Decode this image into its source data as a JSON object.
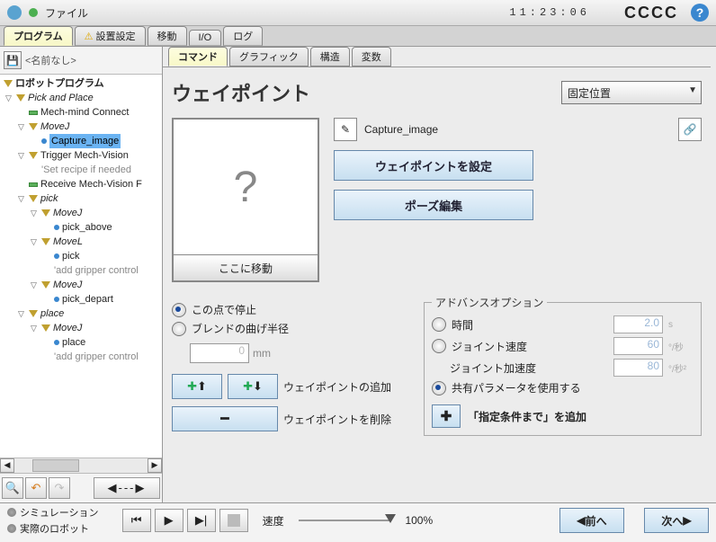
{
  "top": {
    "file_label": "ファイル",
    "clock": "11:23:06",
    "right_text": "CCCC"
  },
  "primary_tabs": [
    "プログラム",
    "設置設定",
    "移動",
    "I/O",
    "ログ"
  ],
  "primary_active": 0,
  "tree_header": {
    "noname": "<名前なし>"
  },
  "tree": {
    "root": "ロボットプログラム",
    "pick_and_place": "Pick and Place",
    "mech_mind": "Mech-mind Connect",
    "movej1": "MoveJ",
    "capture_image": "Capture_image",
    "trigger": "Trigger Mech-Vision",
    "set_recipe": "'Set recipe if needed",
    "receive": "Receive Mech-Vision F",
    "pick_root": "pick",
    "movej2": "MoveJ",
    "pick_above": "pick_above",
    "movel1": "MoveL",
    "pick": "pick",
    "grip1": "'add gripper control",
    "movej3": "MoveJ",
    "pick_depart": "pick_depart",
    "place_root": "place",
    "movej4": "MoveJ",
    "place": "place",
    "grip2": "'add gripper control"
  },
  "subtabs": [
    "コマンド",
    "グラフィック",
    "構造",
    "変数"
  ],
  "subtab_active": 0,
  "waypoint": {
    "title": "ウェイポイント",
    "position_type": "固定位置",
    "preview_placeholder": "?",
    "move_here": "ここに移動",
    "name": "Capture_image",
    "set_btn": "ウェイポイントを設定",
    "edit_btn": "ポーズ編集"
  },
  "stop_blend": {
    "stop_here": "この点で停止",
    "blend_radius": "ブレンドの曲げ半径",
    "blend_value": "0",
    "blend_unit": "mm"
  },
  "wp_ops": {
    "add_label": "ウェイポイントの追加",
    "del_label": "ウェイポイントを削除"
  },
  "adv": {
    "legend": "アドバンスオプション",
    "time": "時間",
    "time_val": "2.0",
    "time_unit": "s",
    "jspeed": "ジョイント速度",
    "jspeed_val": "60",
    "jspeed_unit": "°/秒",
    "jaccel": "ジョイント加速度",
    "jaccel_val": "80",
    "jaccel_unit": "°/秒²",
    "shared": "共有パラメータを使用する",
    "until": "「指定条件まで」を追加"
  },
  "bottom": {
    "simulation": "シミュレーション",
    "real_robot": "実際のロボット",
    "speed_label": "速度",
    "speed_value": "100%",
    "prev": "前へ",
    "next": "次へ"
  }
}
